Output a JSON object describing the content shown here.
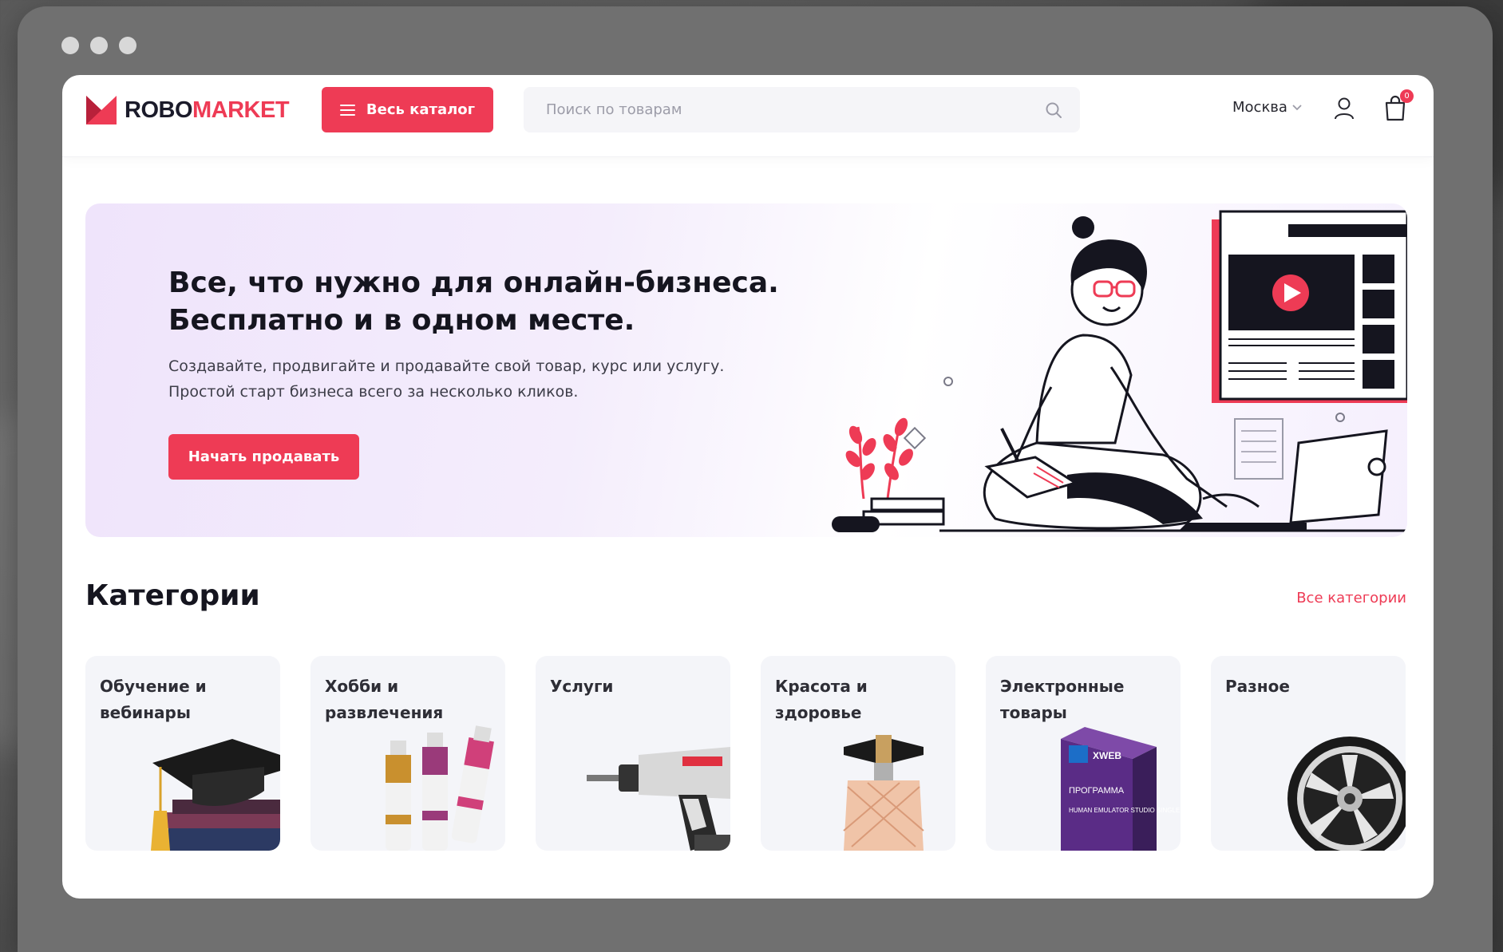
{
  "window": {
    "controls": [
      "close",
      "minimize",
      "maximize"
    ]
  },
  "header": {
    "logo": {
      "part1": "ROBO",
      "part2": "MARKET",
      "icon": "m-logo-icon"
    },
    "catalog_button": {
      "label": "Весь каталог",
      "icon": "menu-icon"
    },
    "search": {
      "placeholder": "Поиск по товарам",
      "value": "",
      "icon": "search-icon"
    },
    "city": {
      "label": "Москва",
      "icon": "chevron-down-icon"
    },
    "user_icon": "user-icon",
    "cart": {
      "icon": "cart-icon",
      "count": "0"
    }
  },
  "hero": {
    "title_line1": "Все, что нужно для онлайн-бизнеса.",
    "title_line2": "Бесплатно и в одном месте.",
    "text_line1": "Создавайте, продвигайте и продавайте свой товар, курс или услугу.",
    "text_line2": "Простой старт бизнеса всего за несколько кликов.",
    "button_label": "Начать продавать"
  },
  "categories": {
    "title": "Категории",
    "all_link": "Все категории",
    "items": [
      {
        "label": "Обучение и вебинары",
        "image": "graduation-cap-image"
      },
      {
        "label": "Хобби и развлечения",
        "image": "paint-tubes-image"
      },
      {
        "label": "Услуги",
        "image": "drill-image"
      },
      {
        "label": "Красота и здоровье",
        "image": "perfume-image"
      },
      {
        "label": "Электронные товары",
        "image": "software-box-image"
      },
      {
        "label": "Разное",
        "image": "wheel-rim-image"
      }
    ],
    "box_text": {
      "brand": "XWEB",
      "title": "ПРОГРАММА",
      "subtitle": "HUMAN EMULATOR STUDIO SINGLE"
    }
  },
  "colors": {
    "accent": "#ee3b55",
    "text": "#15151f",
    "hero_bg": "#efe4fb",
    "card_bg": "#f4f5f9"
  }
}
